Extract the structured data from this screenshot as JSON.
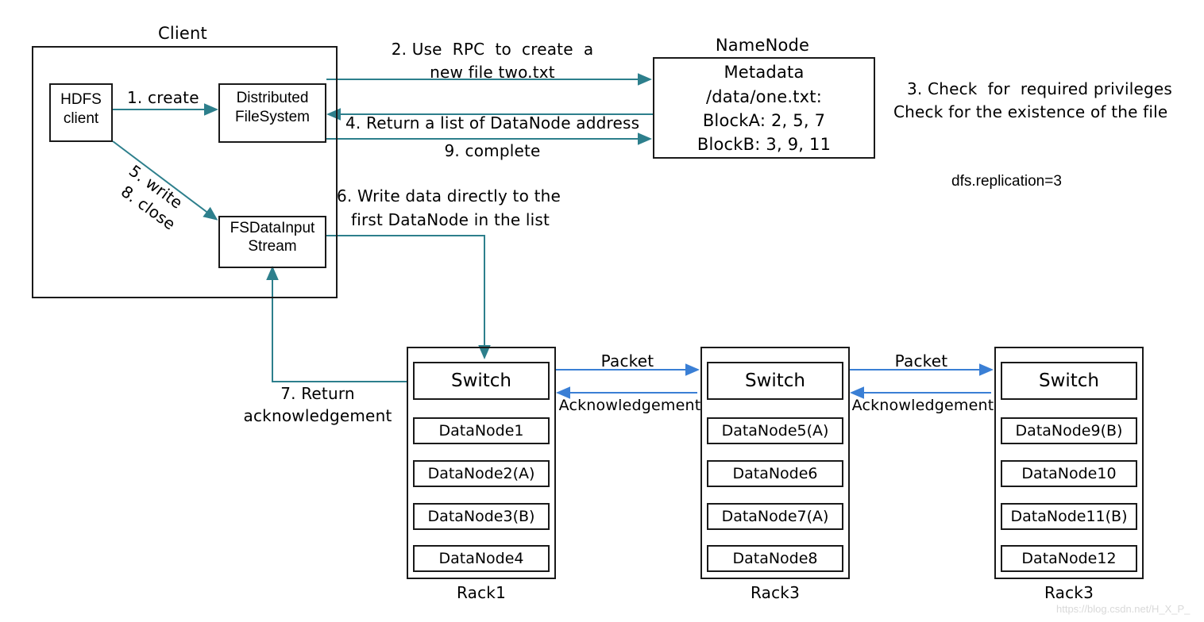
{
  "diagram": {
    "title": "HDFS write data flow",
    "colors": {
      "stroke_box": "#1a1a1a",
      "arrow_teal": "#2d7f8c",
      "arrow_blue": "#3a7fd5",
      "background": "#ffffff",
      "watermark": "#d9d9d9"
    }
  },
  "client": {
    "label": "Client",
    "hdfs_client": "HDFS\nclient",
    "hdfs_client_line1": "HDFS",
    "hdfs_client_line2": "client",
    "distributed_fs_line1": "Distributed",
    "distributed_fs_line2": "FileSystem",
    "fsdata_line1": "FSDataInput",
    "fsdata_line2": "Stream"
  },
  "namenode": {
    "label": "NameNode",
    "lines": [
      "Metadata",
      "/data/one.txt:",
      "BlockA: 2, 5, 7",
      "BlockB: 3, 9, 11"
    ]
  },
  "notes": {
    "check_line1": "3. Check  for  required privileges",
    "check_line2": "Check for the existence of the file",
    "replication": "dfs.replication=3"
  },
  "arrows": {
    "step1": "1. create",
    "step2_line1": "2. Use  RPC  to  create  a",
    "step2_line2": "new file two.txt",
    "step4": "4. Return a list of DataNode address",
    "step5": "5. write",
    "step8": "8. close",
    "step6_line1": "6. Write data directly to the",
    "step6_line2": "first DataNode in the list",
    "step7_line1": "7. Return",
    "step7_line2": "acknowledgement",
    "step9": "9. complete",
    "packet": "Packet",
    "acknowledgement": "Acknowledgement"
  },
  "racks": [
    {
      "name": "Rack1",
      "switch": "Switch",
      "nodes": [
        "DataNode1",
        "DataNode2(A)",
        "DataNode3(B)",
        "DataNode4"
      ]
    },
    {
      "name": "Rack3",
      "switch": "Switch",
      "nodes": [
        "DataNode5(A)",
        "DataNode6",
        "DataNode7(A)",
        "DataNode8"
      ]
    },
    {
      "name": "Rack3",
      "switch": "Switch",
      "nodes": [
        "DataNode9(B)",
        "DataNode10",
        "DataNode11(B)",
        "DataNode12"
      ]
    }
  ],
  "watermark": "https://blog.csdn.net/H_X_P_"
}
